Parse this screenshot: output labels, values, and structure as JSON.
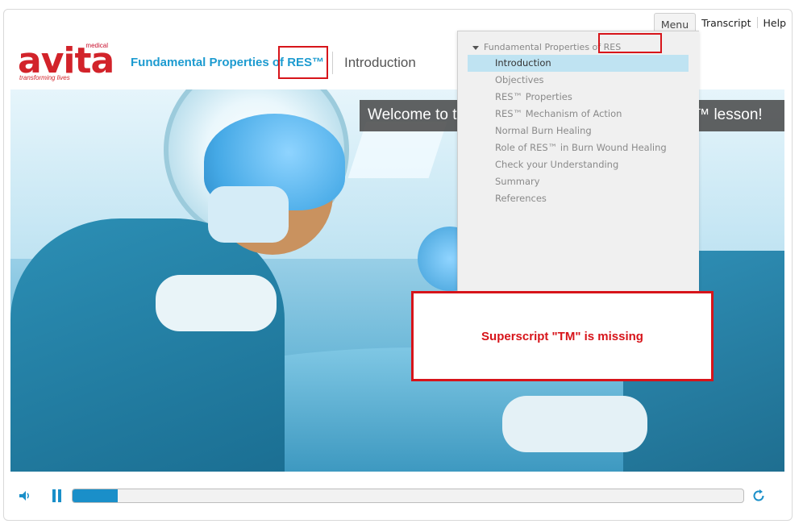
{
  "nav": {
    "menu": "Menu",
    "transcript": "Transcript",
    "help": "Help"
  },
  "logo": {
    "brand": "avita",
    "medical": "medical",
    "tagline": "transforming lives"
  },
  "header": {
    "course_title": "Fundamental Properties of RES™",
    "lesson_title": "Introduction"
  },
  "slide": {
    "welcome_text": "Welcome to the Fundamental Properties of RES™ lesson!"
  },
  "menu_panel": {
    "heading": "Fundamental Properties of RES",
    "items": [
      {
        "label": "Introduction",
        "active": true
      },
      {
        "label": "Objectives",
        "active": false
      },
      {
        "label": "RES™ Properties",
        "active": false
      },
      {
        "label": "RES™ Mechanism of Action",
        "active": false
      },
      {
        "label": "Normal Burn Healing",
        "active": false
      },
      {
        "label": "Role of RES™ in Burn Wound Healing",
        "active": false
      },
      {
        "label": "Check your Understanding",
        "active": false
      },
      {
        "label": "Summary",
        "active": false
      },
      {
        "label": "References",
        "active": false
      }
    ]
  },
  "annotation": {
    "text": "Superscript \"TM\" is missing",
    "color": "#d7141a"
  },
  "player": {
    "progress_fraction": 0.067,
    "accent": "#1a8fc9",
    "icons": [
      "speaker-icon",
      "pause-icon",
      "replay-icon"
    ]
  }
}
